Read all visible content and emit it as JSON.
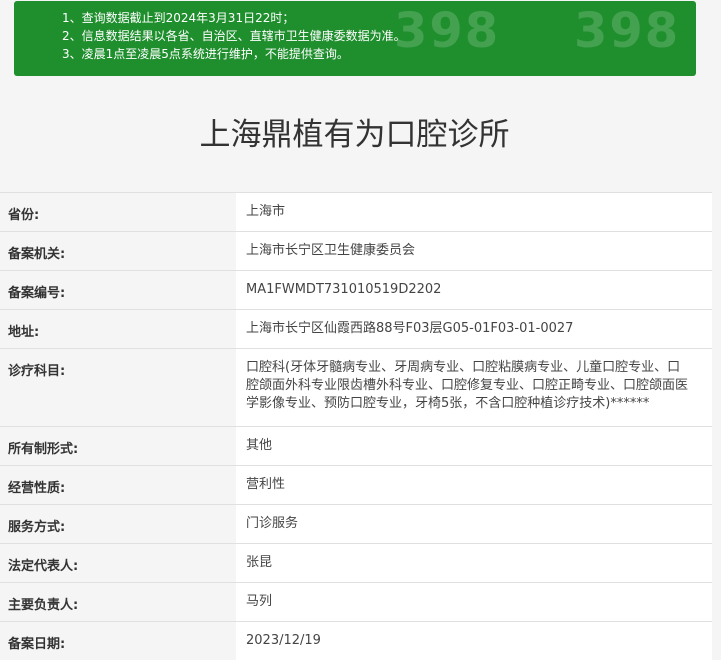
{
  "notice": {
    "lines": [
      "1、查询数据截止到2024年3月31日22时；",
      "2、信息数据结果以各省、自治区、直辖市卫生健康委数据为准。",
      "3、凌晨1点至凌晨5点系统进行维护，不能提供查询。"
    ],
    "watermark": "398"
  },
  "title": "上海鼎植有为口腔诊所",
  "rows": [
    {
      "label": "省份:",
      "value": "上海市"
    },
    {
      "label": "备案机关:",
      "value": "上海市长宁区卫生健康委员会"
    },
    {
      "label": "备案编号:",
      "value": "MA1FWMDT731010519D2202"
    },
    {
      "label": "地址:",
      "value": "上海市长宁区仙霞西路88号F03层G05-01F03-01-0027"
    },
    {
      "label": "诊疗科目:",
      "value": "口腔科(牙体牙髓病专业、牙周病专业、口腔粘膜病专业、儿童口腔专业、口腔颌面外科专业限齿槽外科专业、口腔修复专业、口腔正畸专业、口腔颌面医学影像专业、预防口腔专业，牙椅5张，不含口腔种植诊疗技术)******"
    },
    {
      "label": "所有制形式:",
      "value": "其他"
    },
    {
      "label": "经营性质:",
      "value": "营利性"
    },
    {
      "label": "服务方式:",
      "value": "门诊服务"
    },
    {
      "label": "法定代表人:",
      "value": "张昆"
    },
    {
      "label": "主要负责人:",
      "value": "马列"
    },
    {
      "label": "备案日期:",
      "value": "2023/12/19"
    }
  ]
}
